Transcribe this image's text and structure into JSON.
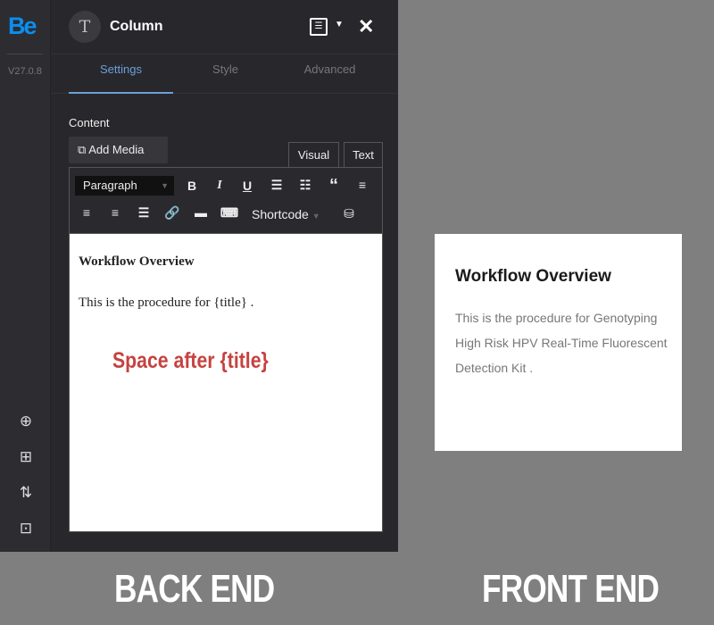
{
  "rail": {
    "logo": "Be",
    "version": "V27.0.8",
    "icons": [
      "add-circle-icon",
      "add-layout-icon",
      "sort-icon",
      "import-icon"
    ]
  },
  "panel": {
    "avatar": "T",
    "title": "Column",
    "tabs": [
      "Settings",
      "Style",
      "Advanced"
    ],
    "active_tab": "Settings",
    "content_label": "Content",
    "add_media": "Add Media",
    "visual": "Visual",
    "text": "Text",
    "format": "Paragraph",
    "shortcode": "Shortcode"
  },
  "editor": {
    "heading": "Workflow Overview",
    "body": "This is the procedure for {title} ."
  },
  "annotation": "Space after {title}",
  "front": {
    "heading": "Workflow Overview",
    "body": "This is the procedure for Genotyping High Risk HPV Real-Time Fluorescent Detection Kit ."
  },
  "labels": {
    "back": "BACK END",
    "front": "FRONT END"
  },
  "colors": {
    "accent": "#6b9fd8",
    "logo": "#0a8ef0",
    "annotation": "#c6423f"
  }
}
